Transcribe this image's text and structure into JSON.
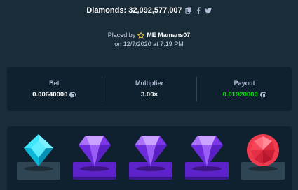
{
  "header": {
    "diamonds_label": "Diamonds: 32,092,577,007",
    "icons": [
      "copy-icon",
      "facebook-icon",
      "twitter-icon"
    ]
  },
  "placed": {
    "prefix": "Placed by",
    "username": "ME Mamans07",
    "datetime": "on 12/7/2020 at 7:19 PM"
  },
  "stats": {
    "bet_label": "Bet",
    "bet_value": "0.00640000",
    "multiplier_label": "Multiplier",
    "multiplier_value": "3.00×",
    "payout_label": "Payout",
    "payout_value": "0.01920000"
  },
  "colors": {
    "background": "#1a2c38",
    "panel": "#0f212e",
    "payout_green": "#00e701",
    "purple_pad": "#5b23c9",
    "grey_pad": "#2f4553"
  },
  "gems": [
    {
      "kind": "cyan-diamond",
      "pad": "grey"
    },
    {
      "kind": "purple-gem",
      "pad": "purple"
    },
    {
      "kind": "purple-gem",
      "pad": "purple"
    },
    {
      "kind": "purple-gem",
      "pad": "purple"
    },
    {
      "kind": "red-gem",
      "pad": "grey"
    }
  ]
}
